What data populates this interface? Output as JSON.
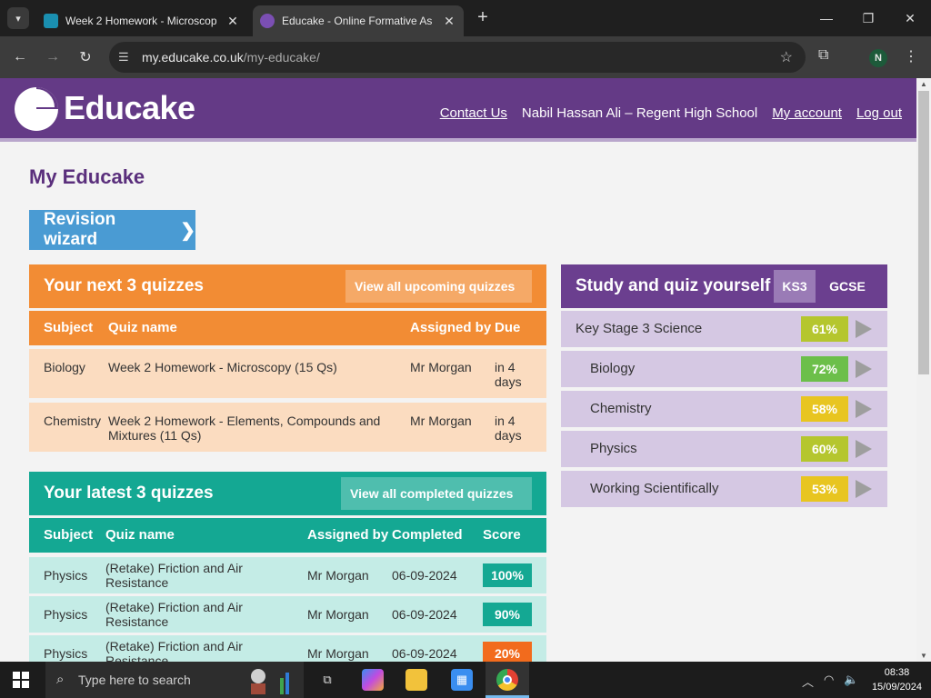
{
  "browser": {
    "tabs": [
      {
        "title": "Week 2 Homework - Microscop",
        "active": false
      },
      {
        "title": "Educake - Online Formative As",
        "active": true
      }
    ],
    "url_host": "my.educake.co.uk",
    "url_path": "/my-educake/",
    "profile_initial": "N"
  },
  "header": {
    "logo": "Educake",
    "links": {
      "contact": "Contact Us",
      "user": "Nabil Hassan Ali – Regent High School",
      "account": "My account",
      "logout": "Log out"
    }
  },
  "page_title": "My Educake",
  "wizard_label": "Revision wizard",
  "next_quizzes": {
    "title": "Your next 3 quizzes",
    "button": "View all upcoming quizzes",
    "columns": [
      "Subject",
      "Quiz name",
      "Assigned by",
      "Due"
    ],
    "rows": [
      {
        "subject": "Biology",
        "quiz": "Week 2 Homework - Microscopy (15 Qs)",
        "by": "Mr Morgan",
        "due": "in 4 days"
      },
      {
        "subject": "Chemistry",
        "quiz": "Week 2 Homework - Elements, Compounds and Mixtures (11 Qs)",
        "by": "Mr Morgan",
        "due": "in 4 days"
      }
    ]
  },
  "latest_quizzes": {
    "title": "Your latest 3 quizzes",
    "button": "View all completed quizzes",
    "columns": [
      "Subject",
      "Quiz name",
      "Assigned by",
      "Completed",
      "Score"
    ],
    "rows": [
      {
        "subject": "Physics",
        "quiz": "(Retake) Friction and Air Resistance",
        "by": "Mr Morgan",
        "completed": "06-09-2024",
        "score": "100%",
        "score_color": "#14a893"
      },
      {
        "subject": "Physics",
        "quiz": "(Retake) Friction and Air Resistance",
        "by": "Mr Morgan",
        "completed": "06-09-2024",
        "score": "90%",
        "score_color": "#14a893"
      },
      {
        "subject": "Physics",
        "quiz": "(Retake) Friction and Air Resistance",
        "by": "Mr Morgan",
        "completed": "06-09-2024",
        "score": "20%",
        "score_color": "#f26b1d"
      }
    ]
  },
  "study": {
    "title": "Study and quiz yourself",
    "levels": [
      "KS3",
      "GCSE"
    ],
    "selected_level": "KS3",
    "rows": [
      {
        "name": "Key Stage 3 Science",
        "pct": "61%",
        "color": "#b5c62e",
        "indent": false
      },
      {
        "name": "Biology",
        "pct": "72%",
        "color": "#6cbf4a",
        "indent": true
      },
      {
        "name": "Chemistry",
        "pct": "58%",
        "color": "#e8c520",
        "indent": true
      },
      {
        "name": "Physics",
        "pct": "60%",
        "color": "#b5c62e",
        "indent": true
      },
      {
        "name": "Working Scientifically",
        "pct": "53%",
        "color": "#e8c520",
        "indent": true
      }
    ]
  },
  "taskbar": {
    "search_placeholder": "Type here to search",
    "time": "08:38",
    "date": "15/09/2024"
  },
  "colors": {
    "brand_purple": "#643a86",
    "orange": "#f28c34",
    "teal": "#14a893",
    "lilac": "#d5c8e3"
  }
}
